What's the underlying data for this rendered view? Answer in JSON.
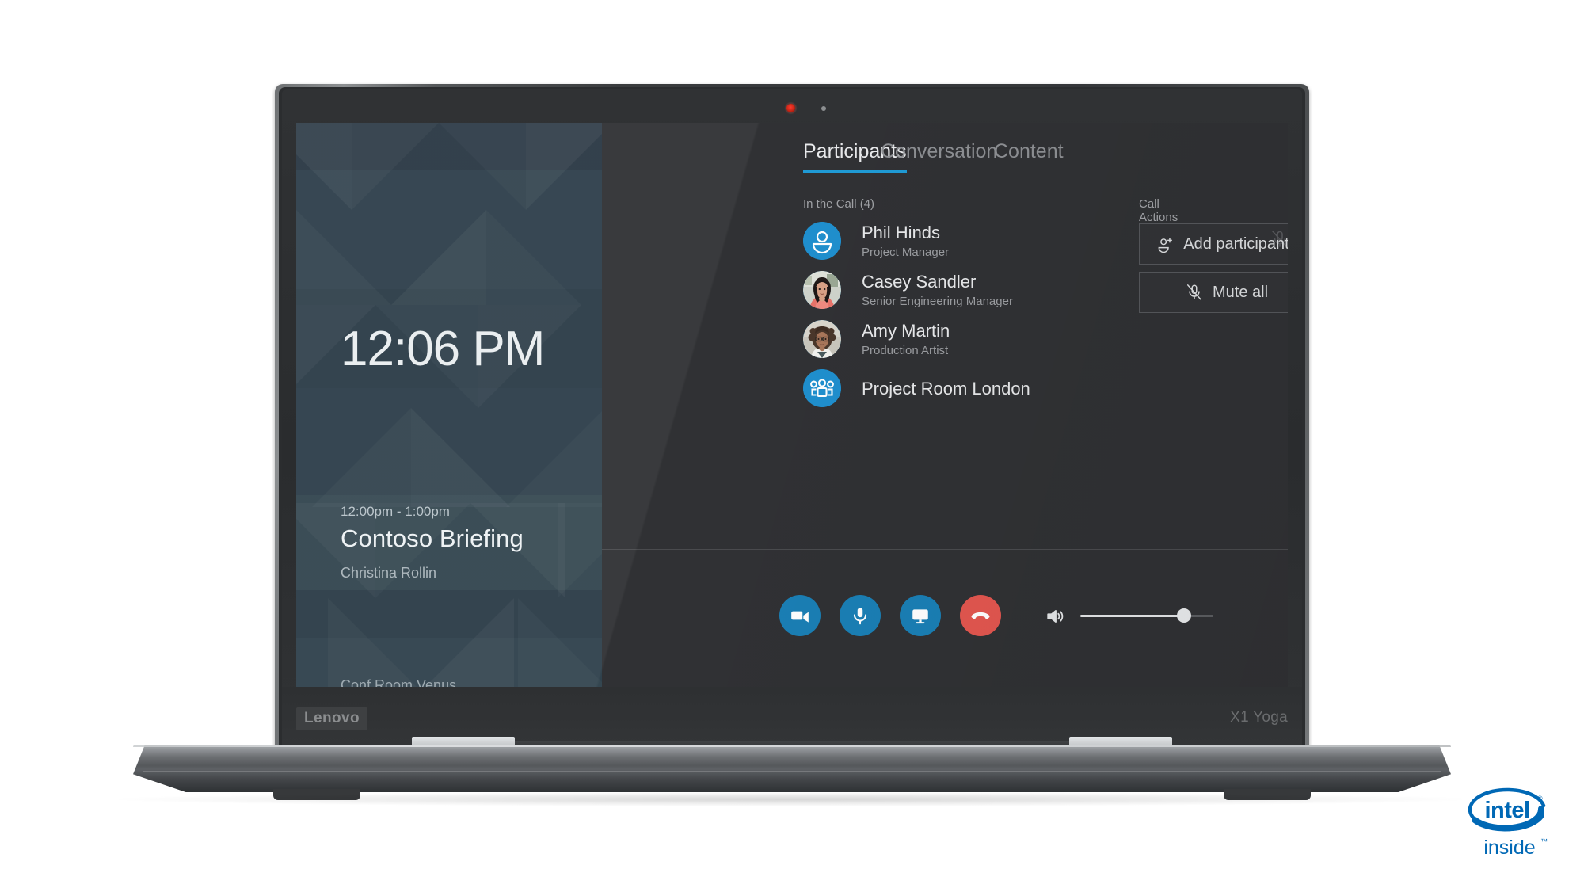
{
  "device": {
    "brand": "Lenovo",
    "model": "X1 Yoga",
    "camera_indicator_icon": "camera-active-dot",
    "sensor_icon": "ir-sensor-dot"
  },
  "badge": {
    "intel_word": "intel",
    "inside_word": "inside",
    "tm_mark": "™",
    "registered_mark": "®",
    "color": "#0068b5"
  },
  "sidebar": {
    "clock": "12:06 PM",
    "meeting": {
      "time_range": "12:00pm - 1:00pm",
      "title": "Contoso Briefing",
      "organizer": "Christina Rollin"
    },
    "room": "Conf Room Venus",
    "background_color": "#2c3c47"
  },
  "main": {
    "accent_color": "#1f9bd6",
    "background_color": "#303134",
    "tabs": [
      {
        "label": "Participants",
        "active": true
      },
      {
        "label": "Conversation",
        "active": false
      },
      {
        "label": "Content",
        "active": false
      }
    ],
    "participants_section": {
      "label": "In the Call (4)",
      "people": [
        {
          "name": "Phil Hinds",
          "role": "Project Manager",
          "avatar_type": "person-icon",
          "muted": true,
          "mute_icon": "mic-muted-icon"
        },
        {
          "name": "Casey Sandler",
          "role": "Senior Engineering Manager",
          "avatar_type": "photo",
          "muted": false
        },
        {
          "name": "Amy Martin",
          "role": "Production Artist",
          "avatar_type": "photo",
          "muted": false
        },
        {
          "name": "Project Room London",
          "role": "",
          "avatar_type": "group-icon",
          "muted": false
        }
      ]
    },
    "call_actions": {
      "label": "Call Actions",
      "buttons": [
        {
          "label": "Add participants",
          "icon": "add-person-icon"
        },
        {
          "label": "Mute all",
          "icon": "mic-muted-icon"
        }
      ]
    },
    "controls": [
      {
        "name": "video",
        "icon": "video-camera-icon",
        "color": "#1a7fb5"
      },
      {
        "name": "microphone",
        "icon": "microphone-icon",
        "color": "#1a7fb5"
      },
      {
        "name": "share-screen",
        "icon": "monitor-icon",
        "color": "#1a7fb5"
      },
      {
        "name": "hang-up",
        "icon": "phone-hangup-icon",
        "color": "#e2564f"
      }
    ],
    "volume": {
      "icon": "speaker-volume-icon",
      "level_percent": 78
    }
  }
}
